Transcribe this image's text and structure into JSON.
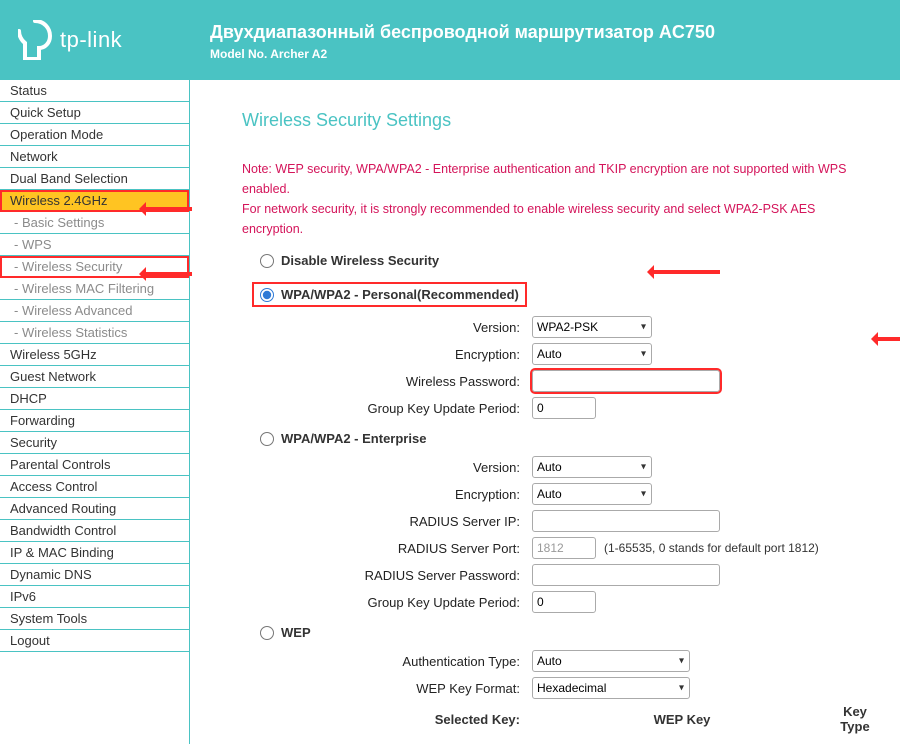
{
  "header": {
    "brand": "tp-link",
    "title": "Двухдиапазонный беспроводной маршрутизатор AC750",
    "model": "Model No. Archer A2"
  },
  "sidebar": {
    "items": [
      {
        "label": "Status"
      },
      {
        "label": "Quick Setup"
      },
      {
        "label": "Operation Mode"
      },
      {
        "label": "Network"
      },
      {
        "label": "Dual Band Selection"
      },
      {
        "label": "Wireless 2.4GHz",
        "highlight": "yellow"
      },
      {
        "label": "- Basic Settings",
        "sub": true
      },
      {
        "label": "- WPS",
        "sub": true
      },
      {
        "label": "- Wireless Security",
        "sub": true,
        "highlight": "red"
      },
      {
        "label": "- Wireless MAC Filtering",
        "sub": true
      },
      {
        "label": "- Wireless Advanced",
        "sub": true
      },
      {
        "label": "- Wireless Statistics",
        "sub": true
      },
      {
        "label": "Wireless 5GHz"
      },
      {
        "label": "Guest Network"
      },
      {
        "label": "DHCP"
      },
      {
        "label": "Forwarding"
      },
      {
        "label": "Security"
      },
      {
        "label": "Parental Controls"
      },
      {
        "label": "Access Control"
      },
      {
        "label": "Advanced Routing"
      },
      {
        "label": "Bandwidth Control"
      },
      {
        "label": "IP & MAC Binding"
      },
      {
        "label": "Dynamic DNS"
      },
      {
        "label": "IPv6"
      },
      {
        "label": "System Tools"
      },
      {
        "label": "Logout"
      }
    ]
  },
  "page": {
    "title": "Wireless Security Settings",
    "note_l1": "Note: WEP security, WPA/WPA2 - Enterprise authentication and TKIP encryption are not supported with WPS enabled.",
    "note_l2": "For network security, it is strongly recommended to enable wireless security and select WPA2-PSK AES encryption."
  },
  "options": {
    "disable": {
      "label": "Disable Wireless Security",
      "checked": false
    },
    "personal": {
      "label": "WPA/WPA2 - Personal(Recommended)",
      "checked": true,
      "version_label": "Version:",
      "version_value": "WPA2-PSK",
      "encryption_label": "Encryption:",
      "encryption_value": "Auto",
      "password_label": "Wireless Password:",
      "password_value": "",
      "gk_label": "Group Key Update Period:",
      "gk_value": "0"
    },
    "enterprise": {
      "label": "WPA/WPA2 - Enterprise",
      "checked": false,
      "version_label": "Version:",
      "version_value": "Auto",
      "encryption_label": "Encryption:",
      "encryption_value": "Auto",
      "radius_ip_label": "RADIUS Server IP:",
      "radius_ip_value": "",
      "radius_port_label": "RADIUS Server Port:",
      "radius_port_value": "1812",
      "radius_port_hint": "(1-65535, 0 stands for default port 1812)",
      "radius_pw_label": "RADIUS Server Password:",
      "radius_pw_value": "",
      "gk_label": "Group Key Update Period:",
      "gk_value": "0"
    },
    "wep": {
      "label": "WEP",
      "checked": false,
      "auth_label": "Authentication Type:",
      "auth_value": "Auto",
      "format_label": "WEP Key Format:",
      "format_value": "Hexadecimal",
      "col_selected": "Selected Key:",
      "col_wepkey": "WEP Key",
      "col_keytype": "Key Type"
    }
  }
}
